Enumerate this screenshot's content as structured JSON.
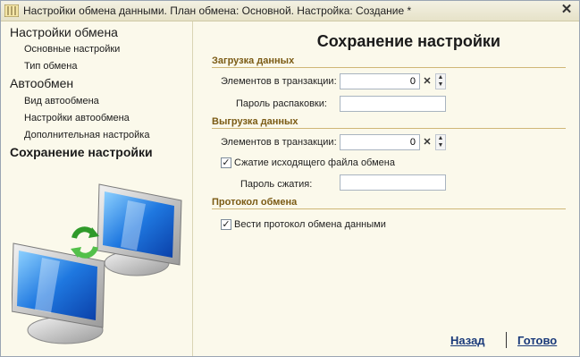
{
  "window": {
    "title": "Настройки обмена данными. План обмена: Основной. Настройка: Создание *"
  },
  "sidebar": {
    "items": [
      {
        "label": "Настройки обмена"
      },
      {
        "label": "Основные настройки"
      },
      {
        "label": "Тип обмена"
      },
      {
        "label": "Автообмен"
      },
      {
        "label": "Вид автообмена"
      },
      {
        "label": "Настройки автообмена"
      },
      {
        "label": "Дополнительная настройка"
      },
      {
        "label": "Сохранение настройки"
      }
    ]
  },
  "main": {
    "title": "Сохранение настройки",
    "load": {
      "header": "Загрузка данных",
      "items_label": "Элементов в транзакции:",
      "items_value": "0",
      "password_label": "Пароль распаковки:",
      "password_value": ""
    },
    "unload": {
      "header": "Выгрузка данных",
      "items_label": "Элементов в транзакции:",
      "items_value": "0",
      "compress_label": "Сжатие исходящего файла обмена",
      "compress_checked": true,
      "password_label": "Пароль сжатия:",
      "password_value": ""
    },
    "protocol": {
      "header": "Протокол обмена",
      "log_label": "Вести протокол обмена данными",
      "log_checked": true
    }
  },
  "footer": {
    "back_label": "Назад",
    "done_label": "Готово"
  },
  "icons": {
    "close": "close-icon",
    "clear": "clear-icon",
    "spin_up": "spin-up-icon",
    "spin_down": "spin-down-icon",
    "check": "check-icon",
    "computers": "computers-illustration",
    "sync": "sync-arrows-icon"
  },
  "colors": {
    "background": "#fbf9eb",
    "section_header": "#7b5b15",
    "link": "#1a3a7a"
  }
}
